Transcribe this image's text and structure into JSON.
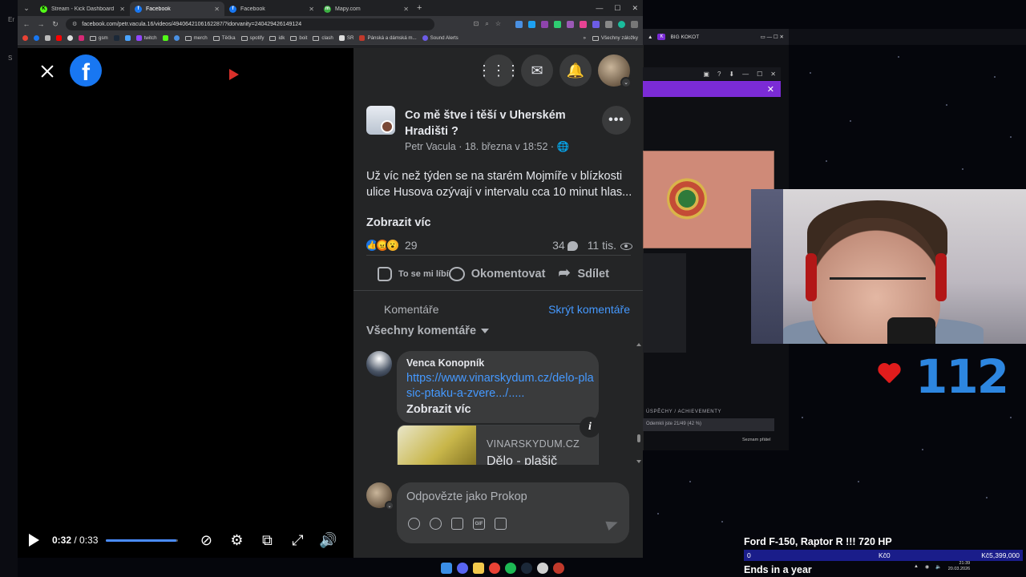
{
  "browser": {
    "tabs": [
      {
        "title": "Stream - Kick Dashboard",
        "icon": "kick-icon",
        "color": "#53fc18",
        "active": false
      },
      {
        "title": "Facebook",
        "icon": "facebook-icon",
        "color": "#1877f2",
        "active": true
      },
      {
        "title": "Facebook",
        "icon": "facebook-icon",
        "color": "#1877f2",
        "active": false
      },
      {
        "title": "Mapy.com",
        "icon": "mapy-icon",
        "color": "#3cb043",
        "active": false
      }
    ],
    "url": "facebook.com/petr.vacula.16/videos/4940642106162287/?idorvanity=240429426149124",
    "bookmarks": [
      "gsm",
      "twitch",
      "merch",
      "Těčka",
      "spotify",
      "idk",
      "boit",
      "clash",
      "SR",
      "Pánská a dámská m...",
      "Sound Alerts"
    ],
    "bookmarks_right": "Všechny záložky"
  },
  "video": {
    "current_time": "0:32",
    "duration": "/ 0:33",
    "progress_fraction": 0.97
  },
  "post": {
    "title": "Co mě štve i těší v Uherském Hradišti ?",
    "author": "Petr Vacula",
    "date": "18. března v 18:52",
    "separator": "·",
    "text": "Už víc než týden se na starém Mojmíře v blízkosti ulice Husova ozývají v intervalu cca 10 minut hlas...",
    "show_more": "Zobrazit víc",
    "reaction_count": "29",
    "comment_count": "34",
    "view_count": "11 tis.",
    "actions": {
      "like": "To se mi líbí",
      "comment": "Okomentovat",
      "share": "Sdílet"
    }
  },
  "comments": {
    "header": "Komentáře",
    "hide": "Skrýt komentáře",
    "sort": "Všechny komentáře",
    "items": [
      {
        "author": "Venca Konopník",
        "link": "https://www.vinarskydum.cz/delo-plasic-ptaku-a-zvere.../.....",
        "show_more": "Zobrazit víc",
        "card_site": "VINARSKYDUM.CZ",
        "card_title": "Dělo - plašič"
      }
    ],
    "reply_placeholder": "Odpovězte jako Prokop"
  },
  "stream_overlay": {
    "kick_window_title": "BIG KOKOT",
    "achievements_label": "ÚSPĚCHY / ACHIEVEMENTY",
    "achievements_progress": "Odemkli jste 21/49 (42 %)",
    "friends_label": "Seznam přátel",
    "heart_rate": "112",
    "goal_title": "Ford F-150, Raptor R !!! 720 HP",
    "goal_start": "0",
    "goal_current": "Kč0",
    "goal_target": "Kč5,399,000",
    "goal_sub": "Ends in a year",
    "clock_time": "21:39",
    "clock_date": "20.03.2026"
  },
  "colors": {
    "fb_blue": "#1877f2",
    "link_blue": "#4599ff",
    "panel_bg": "#242526",
    "heart_red": "#e01c1c",
    "hr_blue": "#2d86e0",
    "goal_bar": "#1a1d8a"
  }
}
